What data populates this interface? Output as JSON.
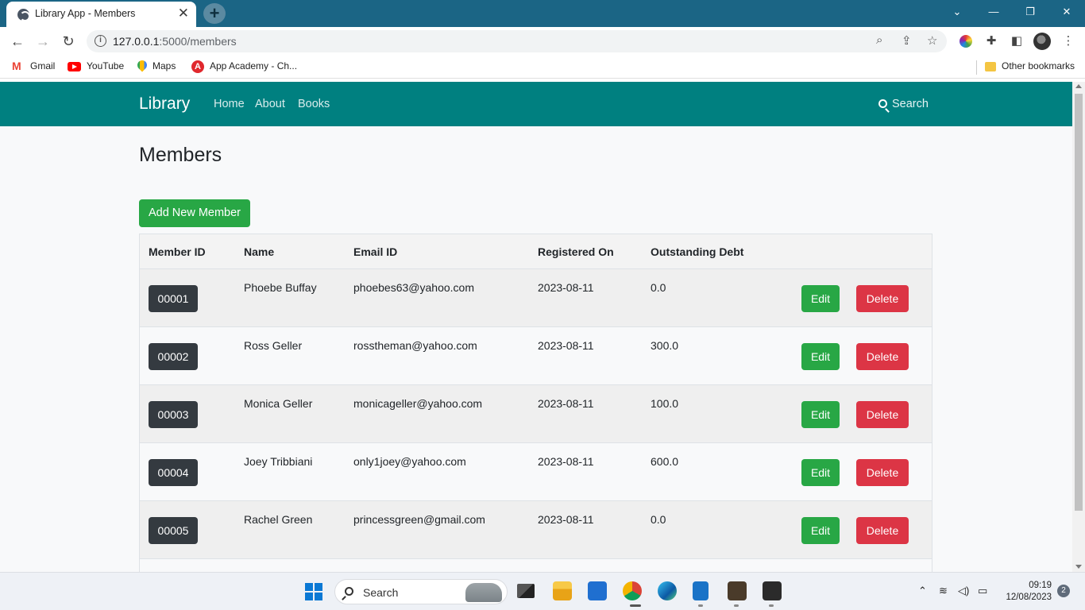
{
  "browser": {
    "tab_title": "Library App - Members",
    "tab_close": "✕",
    "new_tab": "+",
    "window_controls": {
      "collapse": "⌄",
      "minimize": "—",
      "restore": "❐",
      "close": "✕"
    },
    "url_host": "127.0.0.1",
    "url_rest": ":5000/members",
    "nav": {
      "back": "←",
      "forward": "→",
      "reload": "↻"
    }
  },
  "bookmarks": [
    {
      "label": "Gmail",
      "icon": "gmail-icon"
    },
    {
      "label": "YouTube",
      "icon": "youtube-icon"
    },
    {
      "label": "Maps",
      "icon": "maps-icon"
    },
    {
      "label": "App Academy - Ch...",
      "icon": "app-academy-icon",
      "icon_text": "A"
    }
  ],
  "other_bookmarks": "Other bookmarks",
  "app": {
    "brand": "Library",
    "nav_links": [
      "Home",
      "About",
      "Books"
    ],
    "search_label": "Search",
    "page_title": "Members",
    "add_button": "Add New Member",
    "columns": [
      "Member ID",
      "Name",
      "Email ID",
      "Registered On",
      "Outstanding Debt"
    ],
    "edit_label": "Edit",
    "delete_label": "Delete",
    "members": [
      {
        "id": "00001",
        "name": "Phoebe Buffay",
        "email": "phoebes63@yahoo.com",
        "registered": "2023-08-11",
        "debt": "0.0"
      },
      {
        "id": "00002",
        "name": "Ross Geller",
        "email": "rosstheman@yahoo.com",
        "registered": "2023-08-11",
        "debt": "300.0"
      },
      {
        "id": "00003",
        "name": "Monica Geller",
        "email": "monicageller@yahoo.com",
        "registered": "2023-08-11",
        "debt": "100.0"
      },
      {
        "id": "00004",
        "name": "Joey Tribbiani",
        "email": "only1joey@yahoo.com",
        "registered": "2023-08-11",
        "debt": "600.0"
      },
      {
        "id": "00005",
        "name": "Rachel Green",
        "email": "princessgreen@gmail.com",
        "registered": "2023-08-11",
        "debt": "0.0"
      }
    ]
  },
  "taskbar": {
    "search_label": "Search",
    "time": "09:19",
    "date": "12/08/2023",
    "notifications": "2"
  },
  "colors": {
    "navbar": "#008080",
    "success": "#28a745",
    "danger": "#dc3545",
    "badge": "#343a40",
    "tabstrip": "#1b6585"
  }
}
